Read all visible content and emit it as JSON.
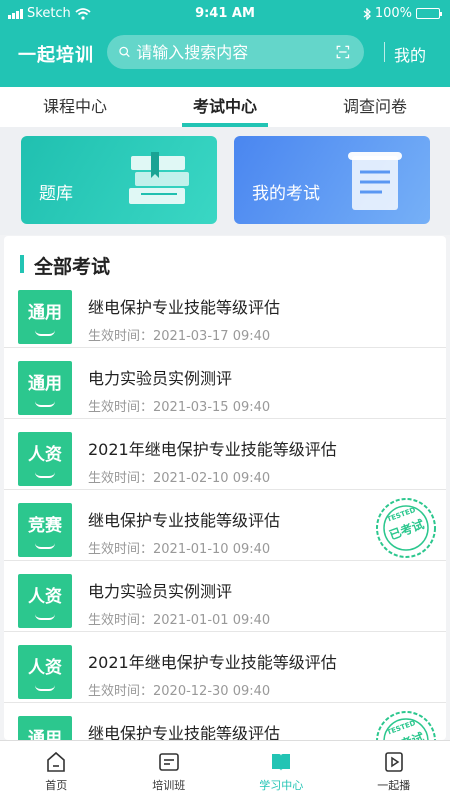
{
  "status_bar": {
    "carrier": "Sketch",
    "time": "9:41 AM",
    "battery": "100%",
    "battery_level": 1.0
  },
  "header": {
    "app_title": "一起培训",
    "search_placeholder": "请输入搜索内容",
    "mine": "我的",
    "accent": "#22c4b4"
  },
  "tabs": [
    {
      "label": "课程中心",
      "active": false
    },
    {
      "label": "考试中心",
      "active": true
    },
    {
      "label": "调查问卷",
      "active": false
    }
  ],
  "cards": {
    "bank": "题库",
    "my_exam": "我的考试"
  },
  "section_title": "全部考试",
  "time_prefix": "生效时间：",
  "stamp": {
    "top_text": "TESTED",
    "main_text": "已考试"
  },
  "exams": [
    {
      "badge": "通用",
      "title": "继电保护专业技能等级评估",
      "time": "2021-03-17 09:40",
      "tested": false
    },
    {
      "badge": "通用",
      "title": "电力实验员实例测评",
      "time": "2021-03-15 09:40",
      "tested": false
    },
    {
      "badge": "人资",
      "title": "2021年继电保护专业技能等级评估",
      "time": "2021-02-10 09:40",
      "tested": false
    },
    {
      "badge": "竞赛",
      "title": "继电保护专业技能等级评估",
      "time": "2021-01-10 09:40",
      "tested": true
    },
    {
      "badge": "人资",
      "title": "电力实验员实例测评",
      "time": "2021-01-01 09:40",
      "tested": false
    },
    {
      "badge": "人资",
      "title": "2021年继电保护专业技能等级评估",
      "time": "2020-12-30 09:40",
      "tested": false
    },
    {
      "badge": "通用",
      "title": "继电保护专业技能等级评估",
      "time": "",
      "tested": true
    }
  ],
  "bottom_nav": [
    {
      "label": "首页",
      "icon": "home-icon",
      "active": false
    },
    {
      "label": "培训班",
      "icon": "class-icon",
      "active": false
    },
    {
      "label": "学习中心",
      "icon": "book-icon",
      "active": true
    },
    {
      "label": "一起播",
      "icon": "play-icon",
      "active": false
    }
  ]
}
